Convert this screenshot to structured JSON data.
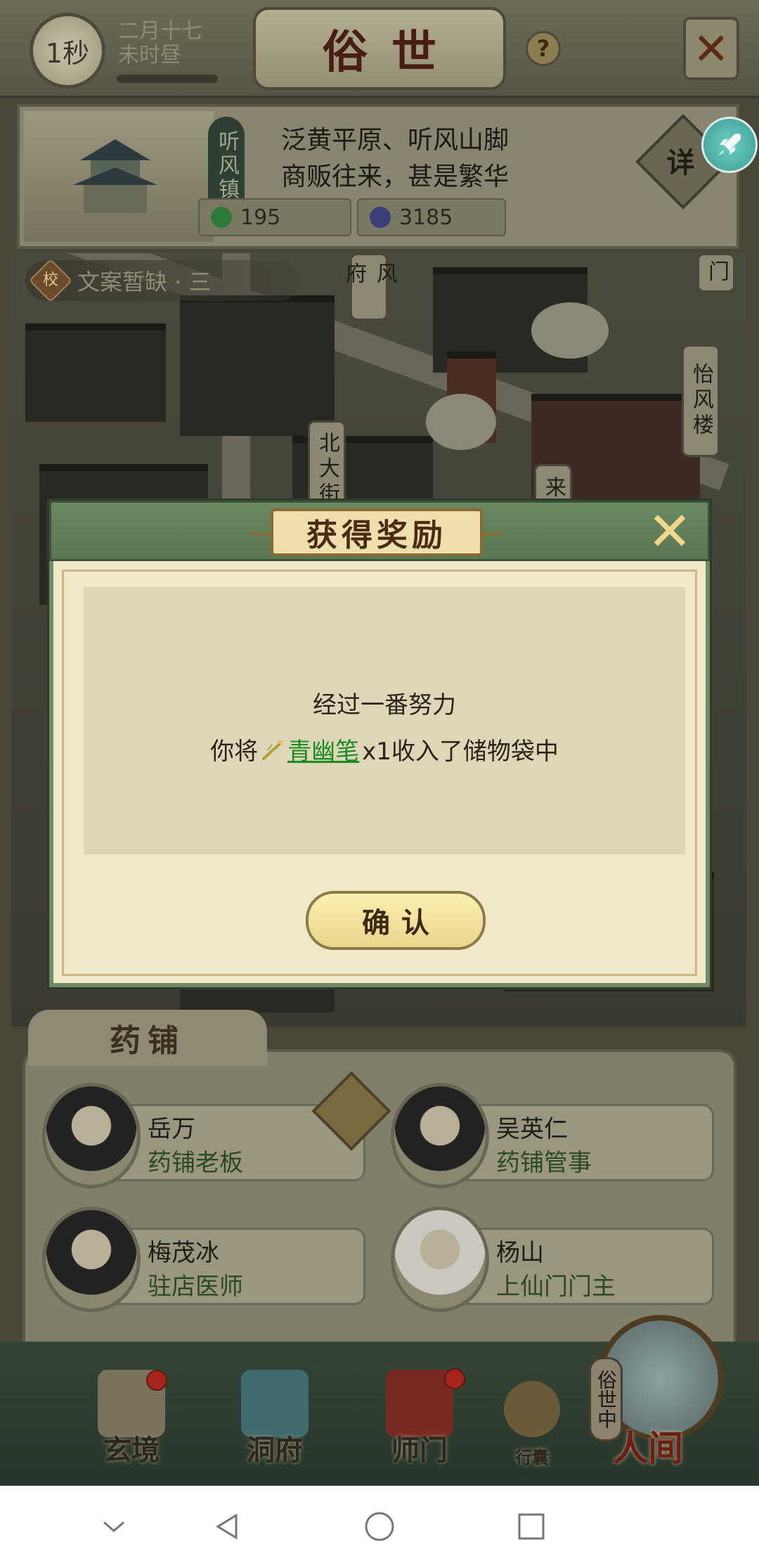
{
  "top_bar": {
    "clock_label": "1秒",
    "date_line1": "二月十七",
    "date_line2": "未时昼",
    "title": "俗世",
    "help_label": "?"
  },
  "location": {
    "town_name": "听风镇",
    "desc_line1": "泛黄平原、听风山脚",
    "desc_line2": "商贩往来，甚是繁华",
    "resource_jade": "195",
    "resource_coin": "3185",
    "detail_label": "详"
  },
  "map": {
    "topic_badge": "校",
    "topic_text": "文案暂缺 · 三",
    "tags": [
      "风府",
      "北大街",
      "门",
      "怡风楼",
      "来"
    ]
  },
  "shop": {
    "title": "药铺",
    "npcs": [
      {
        "name": "岳万",
        "role": "药铺老板"
      },
      {
        "name": "吴英仁",
        "role": "药铺管事"
      },
      {
        "name": "梅茂冰",
        "role": "驻店医师"
      },
      {
        "name": "杨山",
        "role": "上仙门门主"
      }
    ]
  },
  "bottom_nav": {
    "items": [
      {
        "label": "玄境"
      },
      {
        "label": "洞府"
      },
      {
        "label": "师门"
      },
      {
        "label": "行囊"
      }
    ],
    "world_tag": "俗世中",
    "world_label": "人间"
  },
  "modal": {
    "title": "获得奖励",
    "line1": "经过一番努力",
    "prefix": "你将",
    "item_name": "青幽笔",
    "suffix": "x1收入了储物袋中",
    "confirm_label": "确认"
  },
  "colors": {
    "modal_bg": "#f1e8c8",
    "modal_header": "#5a7753",
    "item_link": "#1c8a25"
  }
}
